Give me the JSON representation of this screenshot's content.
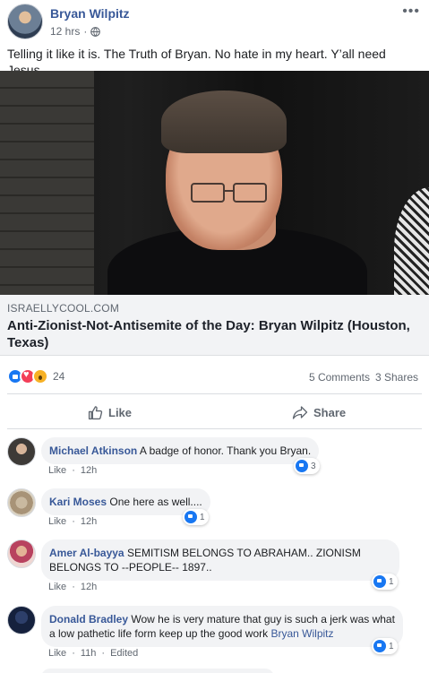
{
  "post": {
    "author": "Bryan Wilpitz",
    "time": "12 hrs",
    "time_separator": "·",
    "text": "Telling it like it is. The Truth of Bryan. No hate in my heart. Y’all need Jesus.",
    "more_icon": "more-dots-icon",
    "privacy_icon": "globe-icon"
  },
  "link": {
    "domain": "ISRAELLYCOOL.COM",
    "title": "Anti-Zionist-Not-Antisemite of the Day: Bryan Wilpitz (Houston, Texas)",
    "info_label": "i"
  },
  "stats": {
    "reaction_icons": [
      "like-icon",
      "love-icon",
      "wow-icon"
    ],
    "reaction_count": "24",
    "comments": "5 Comments",
    "shares": "3 Shares"
  },
  "actions": {
    "like": "Like",
    "share": "Share"
  },
  "comments": [
    {
      "name": "Michael Atkinson",
      "text": "A badge of honor. Thank you Bryan.",
      "like": "Like",
      "time": "12h",
      "reactions": "3"
    },
    {
      "name": "Kari Moses",
      "text": "One here as well....",
      "like": "Like",
      "time": "12h",
      "reactions": "1"
    },
    {
      "name": "Amer Al-bayya",
      "text": "SEMITISM BELONGS TO ABRAHAM.. ZIONISM BELONGS TO --PEOPLE-- 1897..",
      "like": "Like",
      "time": "12h",
      "reactions": "1"
    },
    {
      "name": "Donald Bradley",
      "text": "Wow he is very mature that guy is such a jerk was what a low pathetic life form keep up the good work",
      "mention": "Bryan Wilpitz",
      "like": "Like",
      "time": "11h",
      "edited": "Edited",
      "reactions": "1"
    }
  ],
  "colors": {
    "link_blue": "#385898",
    "like_blue": "#1877f2",
    "love_red": "#f33e58",
    "wow_yellow": "#f7b125",
    "bubble_gray": "#f2f3f5",
    "secondary_text": "#606770"
  }
}
